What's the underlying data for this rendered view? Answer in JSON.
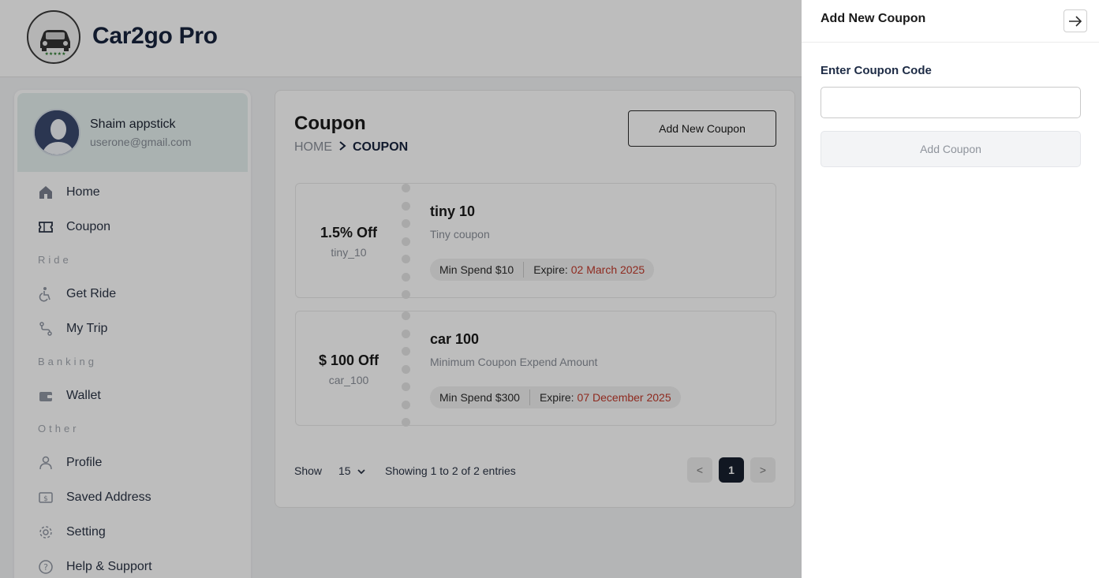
{
  "app": {
    "brand": "Car2go Pro"
  },
  "user": {
    "name": "Shaim appstick",
    "email": "userone@gmail.com"
  },
  "sidebar": {
    "items": [
      {
        "label": "Home",
        "icon": "home-icon"
      },
      {
        "label": "Coupon",
        "icon": "ticket-icon"
      },
      {
        "label": "Get Ride",
        "icon": "accessible-icon"
      },
      {
        "label": "My Trip",
        "icon": "route-icon"
      },
      {
        "label": "Wallet",
        "icon": "wallet-icon"
      },
      {
        "label": "Profile",
        "icon": "user-icon"
      },
      {
        "label": "Saved Address",
        "icon": "dollar-card-icon"
      },
      {
        "label": "Setting",
        "icon": "gear-icon"
      },
      {
        "label": "Help & Support",
        "icon": "help-icon"
      }
    ],
    "sections": {
      "ride": "Ride",
      "banking": "Banking",
      "other": "Other"
    }
  },
  "main": {
    "title": "Coupon",
    "breadcrumb": {
      "home": "HOME",
      "current": "COUPON"
    },
    "add_button": "Add New Coupon",
    "coupons": [
      {
        "off": "1.5% Off",
        "code": "tiny_10",
        "title": "tiny 10",
        "desc": "Tiny coupon",
        "min_spend": "Min Spend $10",
        "expire_label": "Expire:",
        "expire_date": "02 March 2025"
      },
      {
        "off": "$ 100 Off",
        "code": "car_100",
        "title": "car 100",
        "desc": "Minimum Coupon Expend Amount",
        "min_spend": "Min Spend $300",
        "expire_label": "Expire:",
        "expire_date": "07 December 2025"
      }
    ],
    "pagination": {
      "show_label": "Show",
      "page_size": "15",
      "summary": "Showing 1 to 2 of 2 entries",
      "prev": "<",
      "current": "1",
      "next": ">"
    }
  },
  "drawer": {
    "title": "Add New Coupon",
    "field_label": "Enter Coupon Code",
    "input_value": "",
    "submit_label": "Add Coupon"
  },
  "colors": {
    "brand": "#18243d",
    "expire": "#c0392b",
    "active_page": "#18202e"
  }
}
